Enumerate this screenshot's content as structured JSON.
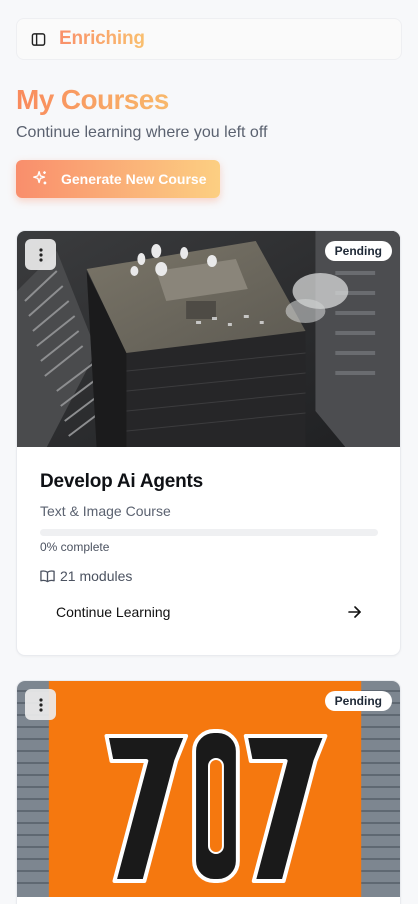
{
  "app": {
    "brand": "Enriching"
  },
  "header": {
    "title": "My Courses",
    "subtitle": "Continue learning where you left off"
  },
  "actions": {
    "generate_label": "Generate New Course"
  },
  "courses": [
    {
      "title": "Develop Ai Agents",
      "type": "Text & Image Course",
      "status": "Pending",
      "progress_percent": 0,
      "progress_text": "0% complete",
      "modules_text": "21 modules",
      "continue_label": "Continue Learning",
      "image_icon": "city-rooftop-image"
    },
    {
      "status": "Pending",
      "image_icon": "sign-707-image"
    }
  ],
  "colors": {
    "accent_start": "#f98e6c",
    "accent_end": "#fccf82",
    "background": "#f7f8fa"
  }
}
